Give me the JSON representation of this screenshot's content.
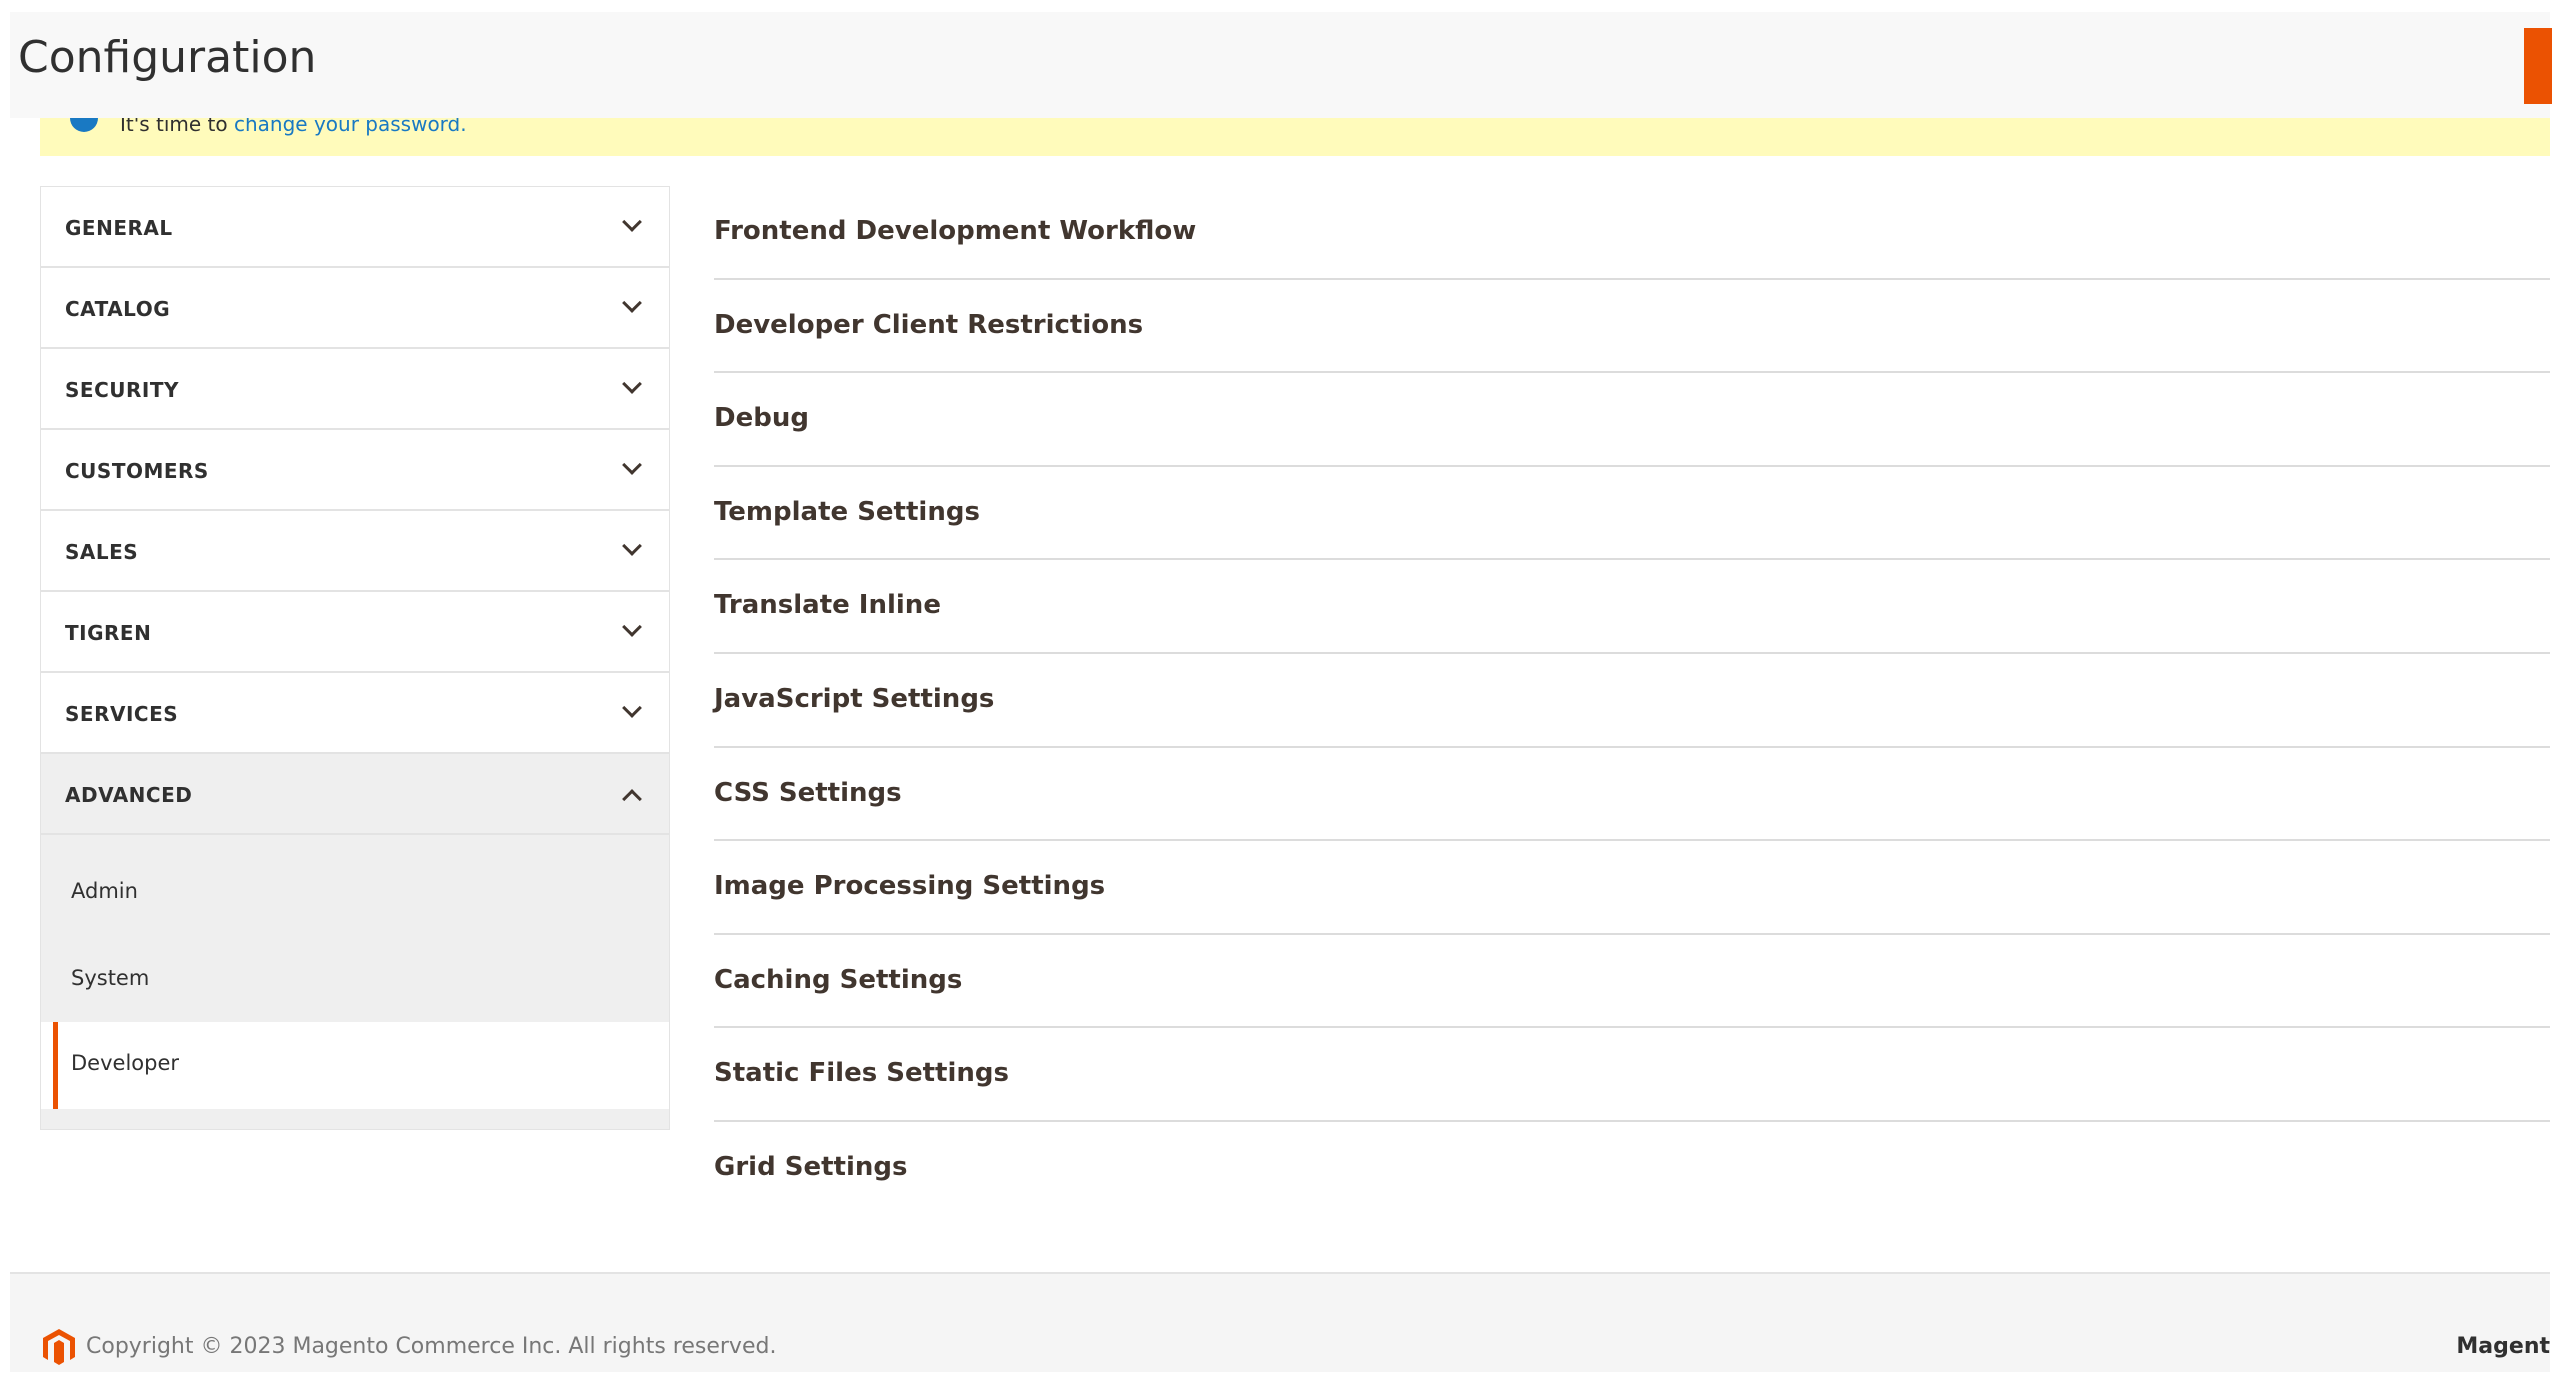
{
  "header": {
    "title": "Configuration"
  },
  "notice": {
    "prefix": "It's time to",
    "link": "change your password."
  },
  "sidebar": {
    "items": [
      {
        "label": "GENERAL"
      },
      {
        "label": "CATALOG"
      },
      {
        "label": "SECURITY"
      },
      {
        "label": "CUSTOMERS"
      },
      {
        "label": "SALES"
      },
      {
        "label": "TIGREN"
      },
      {
        "label": "SERVICES"
      },
      {
        "label": "ADVANCED"
      }
    ],
    "advanced_children": [
      "Admin",
      "System",
      "Developer"
    ],
    "active_child": "Developer"
  },
  "main": {
    "sections": [
      "Frontend Development Workflow",
      "Developer Client Restrictions",
      "Debug",
      "Template Settings",
      "Translate Inline",
      "JavaScript Settings",
      "CSS Settings",
      "Image Processing Settings",
      "Caching Settings",
      "Static Files Settings",
      "Grid Settings"
    ]
  },
  "footer": {
    "copyright": "Copyright © 2023 Magento Commerce Inc. All rights reserved.",
    "right_text": "Magent"
  },
  "colors": {
    "accent": "#eb5202",
    "notice_bg": "#fffbbb",
    "link": "#1979c3"
  }
}
